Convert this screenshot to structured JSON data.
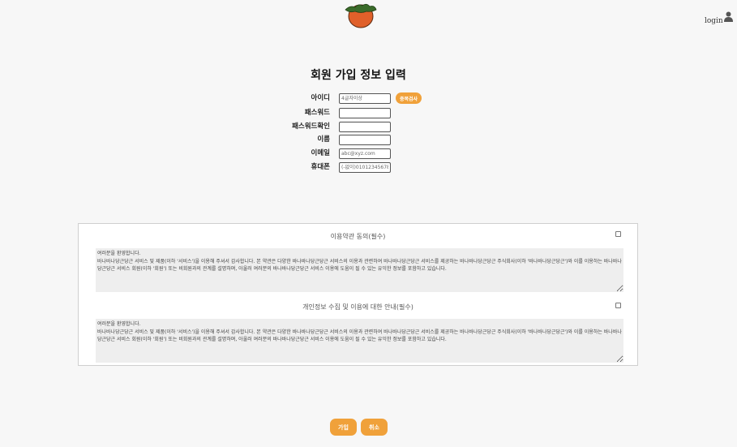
{
  "header": {
    "logo_icon": "carrot-logo-icon",
    "login_label": "login",
    "user_icon": "user-icon"
  },
  "title": "회원 가입 정보 입력",
  "form": {
    "id_label": "아이디",
    "id_placeholder": "4글자이상",
    "duplicate_check_label": "중복검사",
    "password_label": "패스워드",
    "password_confirm_label": "패스워드확인",
    "name_label": "이름",
    "email_label": "이메일",
    "email_placeholder": "abc@xyz.com",
    "phone_label": "휴대폰",
    "phone_placeholder": "(-없이)01012345678"
  },
  "terms": {
    "section1_title": "이용약관 동의(필수)",
    "section1_text": "여러분을 환영합니다.\n바나바나당근당근 서비스 및 제품(이하 '서비스')을 이용해 주셔서 감사합니다. 본 약관은 다양한 바나바나당근당근 서비스의 이용과 관련하여 바나바나당근당근 서비스를 제공하는 바나바나당근당근 주식회사(이하 '바나바나당근당근')와 이를 이용하는 바나바나당근당근 서비스 회원(이하 '회원') 또는 비회원과의 관계를 설명하며, 아울러 여러분의 바나바나당근당근 서비스 이용에 도움이 될 수 있는 유익한 정보를 포함하고 있습니다.",
    "section2_title": "개인정보 수집 및 이용에 대한 안내(필수)",
    "section2_text": "여러분을 환영합니다.\n바나바나당근당근 서비스 및 제품(이하 '서비스')을 이용해 주셔서 감사합니다. 본 약관은 다양한 바나바나당근당근 서비스의 이용과 관련하여 바나바나당근당근 서비스를 제공하는 바나바나당근당근 주식회사(이하 '바나바나당근당근')와 이를 이용하는 바나바나당근당근 서비스 회원(이하 '회원') 또는 비회원과의 관계를 설명하며, 아울러 여러분의 바나바나당근당근 서비스 이용에 도움이 될 수 있는 유익한 정보를 포함하고 있습니다."
  },
  "actions": {
    "join_label": "가입",
    "cancel_label": "취소"
  },
  "colors": {
    "accent": "#f0a13a",
    "background": "#f7f7f7",
    "logo_orange": "#e0602a",
    "logo_green": "#3a6b2a"
  }
}
